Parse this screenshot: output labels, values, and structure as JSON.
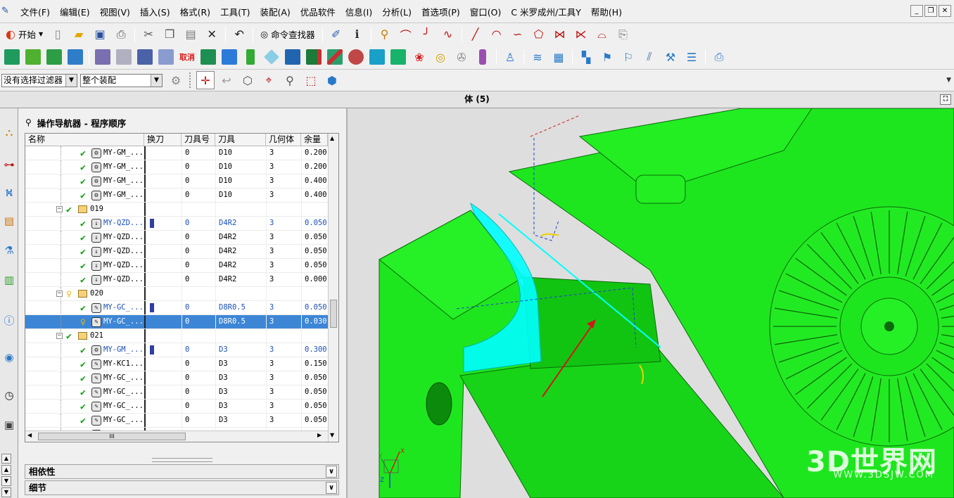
{
  "menu": [
    "文件(F)",
    "编辑(E)",
    "视图(V)",
    "插入(S)",
    "格式(R)",
    "工具(T)",
    "装配(A)",
    "优品软件",
    "信息(I)",
    "分析(L)",
    "首选项(P)",
    "窗口(O)",
    "C  米罗成州/工具Y",
    "帮助(H)"
  ],
  "toolbar1": {
    "start_label": "开始",
    "command_finder_label": "命令查找器"
  },
  "toolbar3": {
    "filter_value": "没有选择过滤器",
    "scope_value": "整个装配"
  },
  "viewbar": {
    "title": "体 (5)"
  },
  "navigator": {
    "title": "操作导航器 - 程序顺序",
    "columns": [
      "名称",
      "换刀",
      "刀具号",
      "刀具",
      "几何体",
      "余量"
    ],
    "rows": [
      {
        "kind": "op",
        "status": "check",
        "icon": "cavity-mill-icon",
        "name": "MY-GM_...",
        "tool_change": false,
        "tool_no": "0",
        "tool": "D10",
        "geom": "3",
        "stock": "0.200",
        "style": "normal"
      },
      {
        "kind": "op",
        "status": "check",
        "icon": "cavity-mill-icon",
        "name": "MY-GM_...",
        "tool_change": false,
        "tool_no": "0",
        "tool": "D10",
        "geom": "3",
        "stock": "0.200",
        "style": "normal"
      },
      {
        "kind": "op",
        "status": "check",
        "icon": "cavity-mill-icon",
        "name": "MY-GM_...",
        "tool_change": false,
        "tool_no": "0",
        "tool": "D10",
        "geom": "3",
        "stock": "0.400",
        "style": "normal"
      },
      {
        "kind": "op",
        "status": "check",
        "icon": "cavity-mill-icon",
        "name": "MY-GM_...",
        "tool_change": false,
        "tool_no": "0",
        "tool": "D10",
        "geom": "3",
        "stock": "0.400",
        "style": "normal"
      },
      {
        "kind": "group",
        "status": "check",
        "name": "019"
      },
      {
        "kind": "op",
        "status": "check",
        "icon": "zlevel-mill-icon",
        "name": "MY-QZD...",
        "tool_change": true,
        "tool_no": "0",
        "tool": "D4R2",
        "geom": "3",
        "stock": "0.050",
        "style": "blue"
      },
      {
        "kind": "op",
        "status": "check",
        "icon": "zlevel-mill-icon",
        "name": "MY-QZD...",
        "tool_change": false,
        "tool_no": "0",
        "tool": "D4R2",
        "geom": "3",
        "stock": "0.050",
        "style": "normal"
      },
      {
        "kind": "op",
        "status": "check",
        "icon": "zlevel-mill-icon",
        "name": "MY-QZD...",
        "tool_change": false,
        "tool_no": "0",
        "tool": "D4R2",
        "geom": "3",
        "stock": "0.050",
        "style": "normal"
      },
      {
        "kind": "op",
        "status": "check",
        "icon": "zlevel-mill-icon",
        "name": "MY-QZD...",
        "tool_change": false,
        "tool_no": "0",
        "tool": "D4R2",
        "geom": "3",
        "stock": "0.050",
        "style": "normal"
      },
      {
        "kind": "op",
        "status": "check",
        "icon": "zlevel-mill-icon",
        "name": "MY-QZD...",
        "tool_change": false,
        "tool_no": "0",
        "tool": "D4R2",
        "geom": "3",
        "stock": "0.000",
        "style": "normal"
      },
      {
        "kind": "group",
        "status": "bulb",
        "name": "020"
      },
      {
        "kind": "op",
        "status": "check",
        "icon": "contour-mill-icon",
        "name": "MY-GC_...",
        "tool_change": true,
        "tool_no": "0",
        "tool": "D8R0.5",
        "geom": "3",
        "stock": "0.050",
        "style": "blue"
      },
      {
        "kind": "op",
        "status": "bulb",
        "icon": "contour-mill-icon",
        "name": "MY-GC_...",
        "tool_change": false,
        "tool_no": "0",
        "tool": "D8R0.5",
        "geom": "3",
        "stock": "0.030",
        "style": "selected"
      },
      {
        "kind": "group",
        "status": "check",
        "name": "021"
      },
      {
        "kind": "op",
        "status": "check",
        "icon": "cavity-mill-icon",
        "name": "MY-GM_...",
        "tool_change": true,
        "tool_no": "0",
        "tool": "D3",
        "geom": "3",
        "stock": "0.300",
        "style": "blue"
      },
      {
        "kind": "op",
        "status": "check",
        "icon": "contour-mill-icon",
        "name": "MY-KC1...",
        "tool_change": false,
        "tool_no": "0",
        "tool": "D3",
        "geom": "3",
        "stock": "0.150",
        "style": "normal"
      },
      {
        "kind": "op",
        "status": "check",
        "icon": "contour-mill-icon",
        "name": "MY-GC_...",
        "tool_change": false,
        "tool_no": "0",
        "tool": "D3",
        "geom": "3",
        "stock": "0.050",
        "style": "normal"
      },
      {
        "kind": "op",
        "status": "check",
        "icon": "contour-mill-icon",
        "name": "MY-GC_...",
        "tool_change": false,
        "tool_no": "0",
        "tool": "D3",
        "geom": "3",
        "stock": "0.050",
        "style": "normal"
      },
      {
        "kind": "op",
        "status": "check",
        "icon": "contour-mill-icon",
        "name": "MY-GC_...",
        "tool_change": false,
        "tool_no": "0",
        "tool": "D3",
        "geom": "3",
        "stock": "0.050",
        "style": "normal"
      },
      {
        "kind": "op",
        "status": "check",
        "icon": "contour-mill-icon",
        "name": "MY-GC_...",
        "tool_change": false,
        "tool_no": "0",
        "tool": "D3",
        "geom": "3",
        "stock": "0.050",
        "style": "normal"
      },
      {
        "kind": "op",
        "status": "check",
        "icon": "contour-mill-icon",
        "name": "MY-GC_...",
        "tool_change": false,
        "tool_no": "0",
        "tool": "D3",
        "geom": "3",
        "stock": "0.050",
        "style": "normal"
      }
    ],
    "hscroll_thumb": "III",
    "sections": [
      "相依性",
      "细节"
    ]
  },
  "viewport": {
    "axis_labels": {
      "x": "X",
      "y": "Y",
      "z": "Z"
    },
    "watermark": "3D世界网",
    "watermark_sub": "WWW.3DSJW.COM",
    "colors": {
      "part": "#1ee61e",
      "toolpath": "#00ffff",
      "background": "#dedede"
    }
  },
  "colors": {
    "selection": "#3d86d6",
    "blue_text": "#1b4fb8",
    "check": "#12a012"
  }
}
